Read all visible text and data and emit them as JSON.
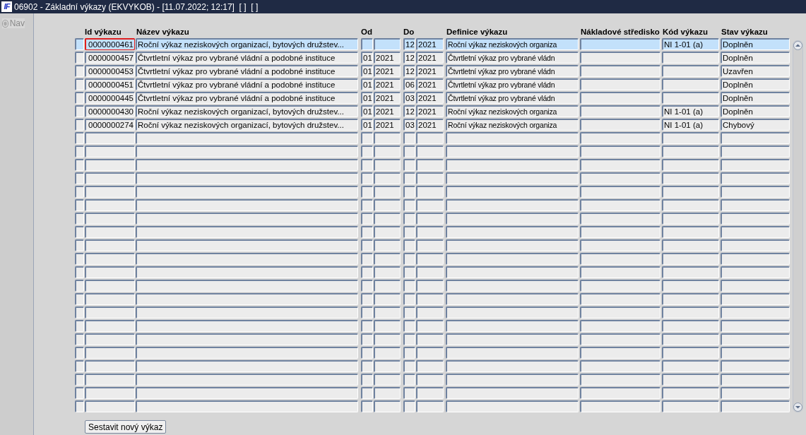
{
  "window": {
    "logo_text": "IF",
    "title": "06902 - Základní výkazy (EKVYKOB) - [11.07.2022; 12:17]  [ ]  [ ]"
  },
  "nav_radio": {
    "label": "Nav",
    "checked": false,
    "disabled": true
  },
  "table": {
    "columns": [
      "Id výkazu",
      "Název výkazu",
      "Od",
      "Do",
      "Definice výkazu",
      "Nákladové středisko",
      "Kód výkazu",
      "Stav výkazu"
    ],
    "rows": [
      {
        "selected": true,
        "focused": true,
        "id": "0000000461",
        "name": "Roční výkaz neziskových organizací, bytových družstev...",
        "do_month": "12",
        "do_year": "2021",
        "definition": "Roční výkaz neziskových organiza",
        "code": "NI 1-01 (a)",
        "status": "Doplněn"
      },
      {
        "selected": false,
        "focused": false,
        "id": "0000000457",
        "name": "Čtvrtletní výkaz pro vybrané vládní a podobné instituce",
        "od_month": "01",
        "od_year": "2021",
        "do_month": "12",
        "do_year": "2021",
        "definition": "Čtvrtletní výkaz pro vybrané vládn",
        "status": "Doplněn"
      },
      {
        "selected": false,
        "focused": false,
        "id": "0000000453",
        "name": "Čtvrtletní výkaz pro vybrané vládní a podobné instituce",
        "od_month": "01",
        "od_year": "2021",
        "do_month": "12",
        "do_year": "2021",
        "definition": "Čtvrtletní výkaz pro vybrané vládn",
        "status": "Uzavřen"
      },
      {
        "selected": false,
        "focused": false,
        "id": "0000000451",
        "name": "Čtvrtletní výkaz pro vybrané vládní a podobné instituce",
        "od_month": "01",
        "od_year": "2021",
        "do_month": "06",
        "do_year": "2021",
        "definition": "Čtvrtletní výkaz pro vybrané vládn",
        "status": "Doplněn"
      },
      {
        "selected": false,
        "focused": false,
        "id": "0000000445",
        "name": "Čtvrtletní výkaz pro vybrané vládní a podobné instituce",
        "od_month": "01",
        "od_year": "2021",
        "do_month": "03",
        "do_year": "2021",
        "definition": "Čtvrtletní výkaz pro vybrané vládn",
        "status": "Doplněn"
      },
      {
        "selected": false,
        "focused": false,
        "id": "0000000430",
        "name": "Roční výkaz neziskových organizací, bytových družstev...",
        "od_month": "01",
        "od_year": "2021",
        "do_month": "12",
        "do_year": "2021",
        "definition": "Roční výkaz neziskových organiza",
        "code": "NI 1-01 (a)",
        "status": "Doplněn"
      },
      {
        "selected": false,
        "focused": false,
        "id": "0000000274",
        "name": "Roční výkaz neziskových organizací, bytových družstev...",
        "od_month": "01",
        "od_year": "2021",
        "do_month": "03",
        "do_year": "2021",
        "definition": "Roční výkaz neziskových organiza",
        "code": "NI 1-01 (a)",
        "status": "Chybový"
      },
      {
        "selected": false,
        "focused": false
      },
      {
        "selected": false,
        "focused": false
      },
      {
        "selected": false,
        "focused": false
      },
      {
        "selected": false,
        "focused": false
      },
      {
        "selected": false,
        "focused": false
      },
      {
        "selected": false,
        "focused": false
      },
      {
        "selected": false,
        "focused": false
      },
      {
        "selected": false,
        "focused": false
      },
      {
        "selected": false,
        "focused": false
      },
      {
        "selected": false,
        "focused": false
      },
      {
        "selected": false,
        "focused": false
      },
      {
        "selected": false,
        "focused": false
      },
      {
        "selected": false,
        "focused": false
      },
      {
        "selected": false,
        "focused": false
      },
      {
        "selected": false,
        "focused": false
      },
      {
        "selected": false,
        "focused": false
      },
      {
        "selected": false,
        "focused": false
      },
      {
        "selected": false,
        "focused": false
      },
      {
        "selected": false,
        "focused": false
      },
      {
        "selected": false,
        "focused": false
      },
      {
        "selected": false,
        "focused": false
      }
    ]
  },
  "button": {
    "label": "Sestavit nový výkaz"
  }
}
